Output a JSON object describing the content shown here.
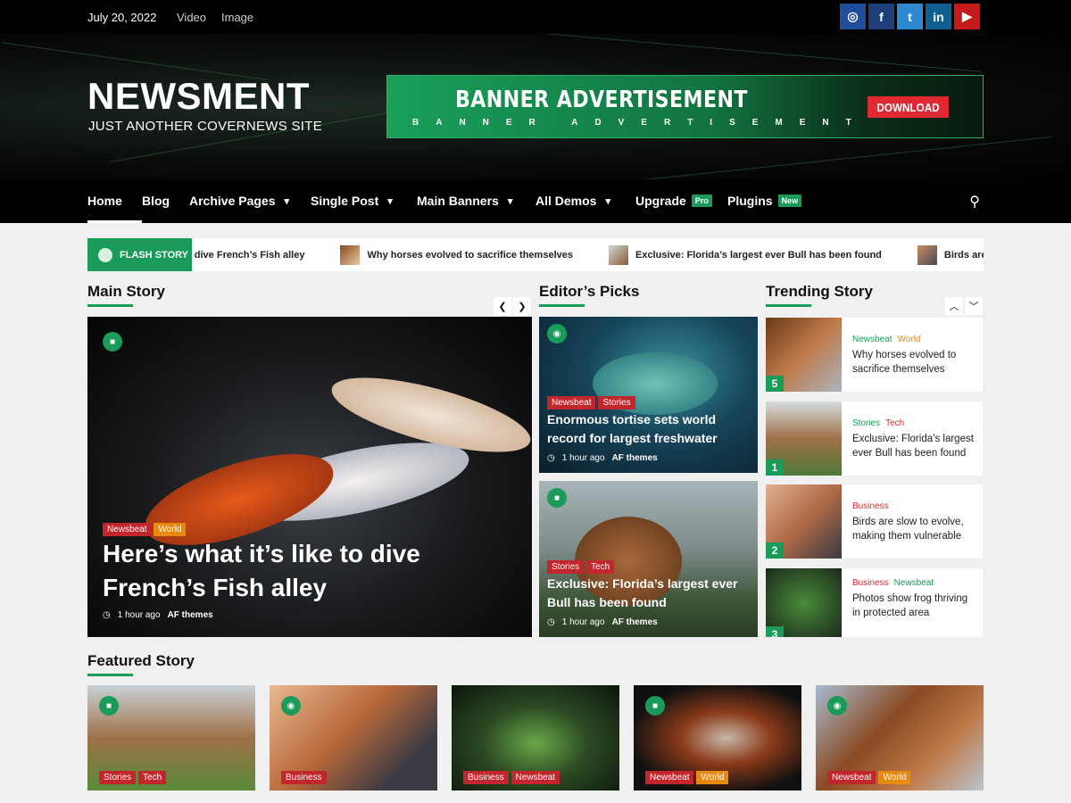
{
  "topbar": {
    "date": "July 20, 2022",
    "links": [
      "Video",
      "Image"
    ]
  },
  "social": [
    {
      "name": "instagram",
      "glyph": "◎",
      "color": "#1f4e9a"
    },
    {
      "name": "facebook",
      "glyph": "f",
      "color": "#1e3f7a"
    },
    {
      "name": "twitter",
      "glyph": "t",
      "color": "#2d8ad1"
    },
    {
      "name": "linkedin",
      "glyph": "in",
      "color": "#0f5f92"
    },
    {
      "name": "youtube",
      "glyph": "▶",
      "color": "#c41a1a"
    }
  ],
  "site": {
    "title": "NEWSMENT",
    "tagline": "JUST ANOTHER COVERNEWS SITE"
  },
  "banner": {
    "title": "BANNER ADVERTISEMENT",
    "subtitle": "BANNER ADVERTISEMENT",
    "button": "DOWNLOAD"
  },
  "nav": {
    "items": [
      {
        "label": "Home"
      },
      {
        "label": "Blog"
      },
      {
        "label": "Archive Pages"
      },
      {
        "label": "Single Post"
      },
      {
        "label": "Main Banners"
      },
      {
        "label": "All Demos"
      },
      {
        "label": "Upgrade",
        "badge": "Pro"
      },
      {
        "label": "Plugins",
        "badge": "New"
      }
    ]
  },
  "flash": {
    "label": "FLASH STORY",
    "items": [
      "Here’s what it’s like to dive French’s Fish alley",
      "Why horses evolved to sacrifice themselves",
      "Exclusive: Florida’s largest ever Bull has been found",
      "Birds are slow to evolve, making them vulnerable"
    ]
  },
  "sections": {
    "main": "Main Story",
    "editors": "Editor’s Picks",
    "trending": "Trending Story",
    "featured": "Featured Story"
  },
  "main_story": {
    "cats": [
      "Newsbeat",
      "World"
    ],
    "title": "Here’s what it’s like to dive French’s Fish alley",
    "time": "1 hour ago",
    "author": "AF themes"
  },
  "editors": [
    {
      "cats": [
        "Newsbeat",
        "Stories"
      ],
      "title": "Enormous tortise sets world record for largest freshwater",
      "time": "1 hour ago",
      "author": "AF themes"
    },
    {
      "cats": [
        "Stories",
        "Tech"
      ],
      "title": "Exclusive: Florida’s largest ever Bull has been found",
      "time": "1 hour ago",
      "author": "AF themes"
    }
  ],
  "trending": [
    {
      "num": "5",
      "cats": [
        "Newsbeat",
        "World"
      ],
      "title": "Why horses evolved to sacrifice themselves"
    },
    {
      "num": "1",
      "cats": [
        "Stories",
        "Tech"
      ],
      "title": "Exclusive: Florida’s largest ever Bull has been found"
    },
    {
      "num": "2",
      "cats": [
        "Business"
      ],
      "title": "Birds are slow to evolve, making them vulnerable"
    },
    {
      "num": "3",
      "cats": [
        "Business",
        "Newsbeat"
      ],
      "title": "Photos show frog thriving in protected area"
    }
  ],
  "featured": [
    {
      "cats": [
        "Stories",
        "Tech"
      ]
    },
    {
      "cats": [
        "Business"
      ]
    },
    {
      "cats": [
        "Business",
        "Newsbeat"
      ]
    },
    {
      "cats": [
        "Newsbeat",
        "World"
      ]
    },
    {
      "cats": [
        "Newsbeat",
        "World"
      ]
    }
  ]
}
